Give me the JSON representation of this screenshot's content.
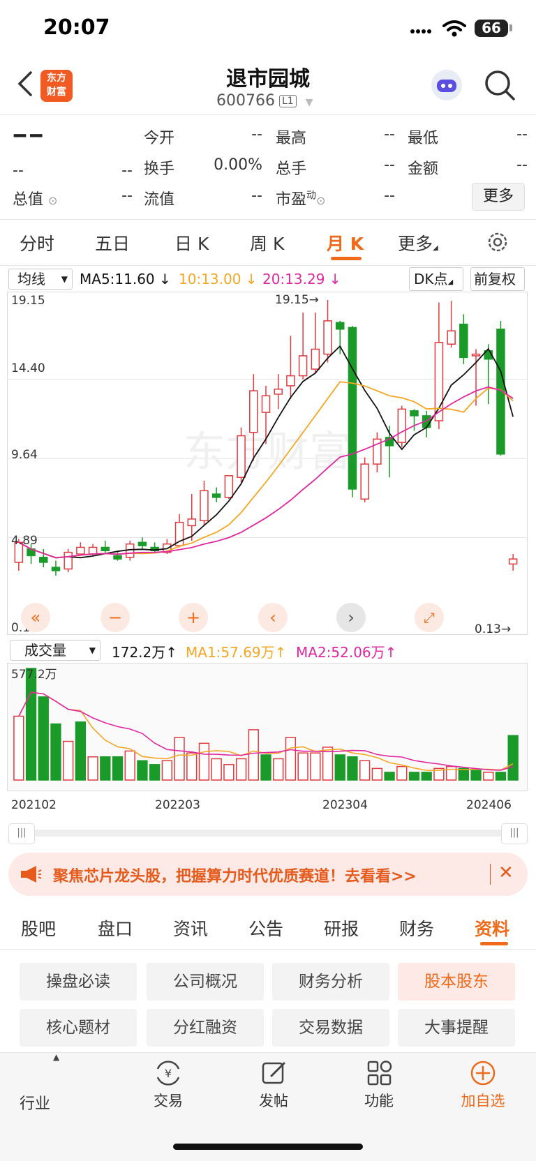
{
  "status": {
    "time": "20:07",
    "battery": "66"
  },
  "header": {
    "title": "退市园城",
    "code": "600766",
    "level_badge": "L1",
    "logo_text_1": "东方",
    "logo_text_2": "财富"
  },
  "quote": {
    "price": "-- --",
    "change": "--",
    "change_pct": "--",
    "fields": [
      {
        "label": "今开",
        "value": "--"
      },
      {
        "label": "最高",
        "value": "--"
      },
      {
        "label": "最低",
        "value": "--"
      },
      {
        "label": "换手",
        "value": "0.00%"
      },
      {
        "label": "总手",
        "value": "--"
      },
      {
        "label": "金额",
        "value": "--"
      },
      {
        "label": "总值",
        "value": "--"
      },
      {
        "label": "流值",
        "value": "--"
      },
      {
        "label": "市盈",
        "value": "--",
        "superscript": "动"
      }
    ],
    "more_label": "更多"
  },
  "period_tabs": {
    "items": [
      "分时",
      "五日",
      "日 K",
      "周 K",
      "月 K",
      "更多"
    ],
    "active": "月 K"
  },
  "kline": {
    "indicator_select": "均线",
    "ma5": "MA5:11.60 ↓",
    "ma10": "10:13.00 ↓",
    "ma20": "20:13.29 ↓",
    "dk_label": "DK点",
    "adjust_label": "前复权",
    "y_labels": [
      "19.15",
      "14.40",
      "9.64",
      "4.89",
      "0.13"
    ],
    "max_marker": "19.15→",
    "min_marker": "0.13→",
    "colors": {
      "up": "#e0393e",
      "down": "#1a9a28",
      "ma5": "#111111",
      "ma10": "#f5a623",
      "ma20": "#e0279f"
    }
  },
  "volume": {
    "indicator_select": "成交量",
    "value": "172.2万↑",
    "ma1": "MA1:57.69万↑",
    "ma2": "MA2:52.06万↑",
    "max_label": "577.2万",
    "x_labels": [
      "202102",
      "202203",
      "202304",
      "202406"
    ]
  },
  "chart_data": {
    "type": "candlestick",
    "ylim": [
      0.13,
      19.15
    ],
    "candles": [
      {
        "o": 3.4,
        "c": 4.6,
        "h": 4.8,
        "l": 2.9
      },
      {
        "o": 4.2,
        "c": 3.8,
        "h": 4.5,
        "l": 3.3
      },
      {
        "o": 3.7,
        "c": 3.4,
        "h": 4.2,
        "l": 3.1
      },
      {
        "o": 3.1,
        "c": 2.9,
        "h": 3.5,
        "l": 2.6
      },
      {
        "o": 3.0,
        "c": 4.0,
        "h": 4.2,
        "l": 2.8
      },
      {
        "o": 3.9,
        "c": 4.3,
        "h": 4.6,
        "l": 3.8
      },
      {
        "o": 3.9,
        "c": 4.3,
        "h": 4.5,
        "l": 3.8
      },
      {
        "o": 4.3,
        "c": 4.1,
        "h": 4.7,
        "l": 3.9
      },
      {
        "o": 3.8,
        "c": 3.6,
        "h": 4.1,
        "l": 3.5
      },
      {
        "o": 3.7,
        "c": 4.5,
        "h": 4.7,
        "l": 3.5
      },
      {
        "o": 4.6,
        "c": 4.4,
        "h": 4.9,
        "l": 4.2
      },
      {
        "o": 4.3,
        "c": 4.1,
        "h": 4.6,
        "l": 4.0
      },
      {
        "o": 4.0,
        "c": 4.5,
        "h": 4.8,
        "l": 3.9
      },
      {
        "o": 4.4,
        "c": 5.8,
        "h": 6.3,
        "l": 4.3
      },
      {
        "o": 5.6,
        "c": 6.0,
        "h": 7.5,
        "l": 4.7
      },
      {
        "o": 5.9,
        "c": 7.7,
        "h": 8.3,
        "l": 5.6
      },
      {
        "o": 7.5,
        "c": 7.3,
        "h": 7.9,
        "l": 7.0
      },
      {
        "o": 7.3,
        "c": 8.6,
        "h": 8.6,
        "l": 7.2
      },
      {
        "o": 8.5,
        "c": 11.0,
        "h": 11.5,
        "l": 8.2
      },
      {
        "o": 11.2,
        "c": 13.7,
        "h": 14.7,
        "l": 9.5
      },
      {
        "o": 12.4,
        "c": 13.4,
        "h": 14.0,
        "l": 10.5
      },
      {
        "o": 13.5,
        "c": 13.8,
        "h": 14.7,
        "l": 12.6
      },
      {
        "o": 14.0,
        "c": 14.6,
        "h": 17.0,
        "l": 13.2
      },
      {
        "o": 14.6,
        "c": 15.8,
        "h": 18.4,
        "l": 14.4
      },
      {
        "o": 15.0,
        "c": 16.2,
        "h": 18.4,
        "l": 14.8
      },
      {
        "o": 15.9,
        "c": 17.9,
        "h": 19.15,
        "l": 15.4
      },
      {
        "o": 17.8,
        "c": 17.4,
        "h": 17.9,
        "l": 15.9
      },
      {
        "o": 17.5,
        "c": 7.8,
        "h": 17.6,
        "l": 7.3
      },
      {
        "o": 7.2,
        "c": 9.3,
        "h": 9.7,
        "l": 7.0
      },
      {
        "o": 9.3,
        "c": 10.8,
        "h": 11.2,
        "l": 8.8
      },
      {
        "o": 10.9,
        "c": 10.4,
        "h": 11.6,
        "l": 8.5
      },
      {
        "o": 10.6,
        "c": 12.6,
        "h": 12.8,
        "l": 10.3
      },
      {
        "o": 12.5,
        "c": 12.2,
        "h": 12.6,
        "l": 11.3
      },
      {
        "o": 12.2,
        "c": 11.5,
        "h": 12.5,
        "l": 10.9
      },
      {
        "o": 11.9,
        "c": 16.6,
        "h": 19.0,
        "l": 11.4
      },
      {
        "o": 16.5,
        "c": 17.3,
        "h": 19.1,
        "l": 16.3
      },
      {
        "o": 17.7,
        "c": 15.7,
        "h": 18.3,
        "l": 15.3
      },
      {
        "o": 15.8,
        "c": 15.9,
        "h": 16.2,
        "l": 12.8
      },
      {
        "o": 16.1,
        "c": 15.6,
        "h": 16.5,
        "l": 12.9
      },
      {
        "o": 17.4,
        "c": 9.9,
        "h": 17.9,
        "l": 9.8
      },
      {
        "o": 3.3,
        "c": 3.6,
        "h": 3.9,
        "l": 2.9
      }
    ],
    "volume_max": 577.2,
    "volumes": [
      {
        "v": 330,
        "up": true
      },
      {
        "v": 577,
        "up": false
      },
      {
        "v": 430,
        "up": false
      },
      {
        "v": 290,
        "up": false
      },
      {
        "v": 200,
        "up": true
      },
      {
        "v": 300,
        "up": false
      },
      {
        "v": 120,
        "up": true
      },
      {
        "v": 120,
        "up": false
      },
      {
        "v": 120,
        "up": false
      },
      {
        "v": 150,
        "up": true
      },
      {
        "v": 100,
        "up": false
      },
      {
        "v": 80,
        "up": false
      },
      {
        "v": 100,
        "up": true
      },
      {
        "v": 220,
        "up": true
      },
      {
        "v": 140,
        "up": true
      },
      {
        "v": 190,
        "up": true
      },
      {
        "v": 110,
        "up": true
      },
      {
        "v": 80,
        "up": true
      },
      {
        "v": 110,
        "up": true
      },
      {
        "v": 260,
        "up": true
      },
      {
        "v": 130,
        "up": false
      },
      {
        "v": 110,
        "up": true
      },
      {
        "v": 220,
        "up": true
      },
      {
        "v": 140,
        "up": true
      },
      {
        "v": 140,
        "up": true
      },
      {
        "v": 170,
        "up": true
      },
      {
        "v": 130,
        "up": false
      },
      {
        "v": 120,
        "up": false
      },
      {
        "v": 100,
        "up": true
      },
      {
        "v": 60,
        "up": true
      },
      {
        "v": 40,
        "up": false
      },
      {
        "v": 70,
        "up": true
      },
      {
        "v": 40,
        "up": false
      },
      {
        "v": 40,
        "up": false
      },
      {
        "v": 60,
        "up": true
      },
      {
        "v": 70,
        "up": true
      },
      {
        "v": 60,
        "up": false
      },
      {
        "v": 50,
        "up": false
      },
      {
        "v": 40,
        "up": true
      },
      {
        "v": 40,
        "up": false
      },
      {
        "v": 230,
        "up": false
      }
    ]
  },
  "banner": {
    "text": "聚焦芯片龙头股，把握算力时代优质赛道！去看看>>"
  },
  "bottom_tabs": {
    "items": [
      "股吧",
      "盘口",
      "资讯",
      "公告",
      "研报",
      "财务",
      "资料"
    ],
    "active": "资料"
  },
  "info_buttons": [
    "操盘必读",
    "公司概况",
    "财务分析",
    "股本股东",
    "核心题材",
    "分红融资",
    "交易数据",
    "大事提醒"
  ],
  "info_active": "股本股东",
  "toolbar": {
    "industry": "行业",
    "trade": "交易",
    "post": "发帖",
    "func": "功能",
    "add": "加自选"
  }
}
